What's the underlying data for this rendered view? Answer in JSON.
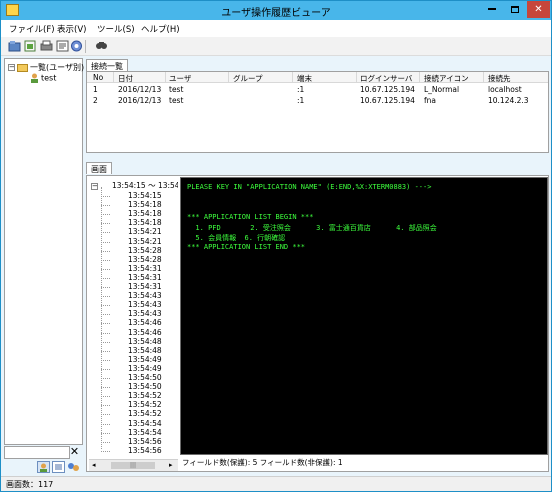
{
  "window": {
    "title": "ユーザ操作履歴ビューア"
  },
  "menu": [
    "ファイル(F)",
    "表示(V)",
    "ツール(S)",
    "ヘルプ(H)"
  ],
  "toolbar": {
    "icons": [
      "open-icon",
      "export-icon",
      "print-icon",
      "settings-icon",
      "filter-icon",
      "search-icon"
    ]
  },
  "tree": {
    "root_label": "一覧(ユーザ別)",
    "child_label": "test"
  },
  "connections": {
    "tab_label": "接続一覧",
    "columns": [
      "No",
      "日付",
      "ユーザ",
      "グループ",
      "端末",
      "ログインサーバ",
      "接続アイコン",
      "接続先"
    ],
    "rows": [
      [
        "1",
        "2016/12/13",
        "test",
        "",
        ":1",
        "10.67.125.194",
        "L_Normal",
        "localhost"
      ],
      [
        "2",
        "2016/12/13",
        "test",
        "",
        ":1",
        "10.67.125.194",
        "fna",
        "10.124.2.3"
      ]
    ]
  },
  "screen": {
    "tab_label": "画面",
    "range_label": "13:54:15 〜 13:54:5",
    "times": [
      "13:54:15",
      "13:54:18",
      "13:54:18",
      "13:54:18",
      "13:54:21",
      "13:54:21",
      "13:54:28",
      "13:54:28",
      "13:54:31",
      "13:54:31",
      "13:54:31",
      "13:54:43",
      "13:54:43",
      "13:54:43",
      "13:54:46",
      "13:54:46",
      "13:54:48",
      "13:54:48",
      "13:54:49",
      "13:54:49",
      "13:54:50",
      "13:54:50",
      "13:54:52",
      "13:54:52",
      "13:54:52",
      "13:54:54",
      "13:54:54",
      "13:54:56",
      "13:54:56"
    ],
    "terminal_lines": [
      "PLEASE KEY IN \"APPLICATION NAME\" (E:END,%X:XTERM0883) --->",
      "",
      "",
      "*** APPLICATION LIST BEGIN ***",
      "  1. PFD       2. 受注照会      3. 富士通百貨店      4. 部品照会",
      "  5. 会員情報  6. 行朝確認",
      "*** APPLICATION LIST END ***"
    ],
    "field_status": "フィールド数(保護): 5  フィールド数(非保護): 1",
    "terminal_text_color": "#3dff3d"
  },
  "status": {
    "screen_count": "画面数：117"
  }
}
